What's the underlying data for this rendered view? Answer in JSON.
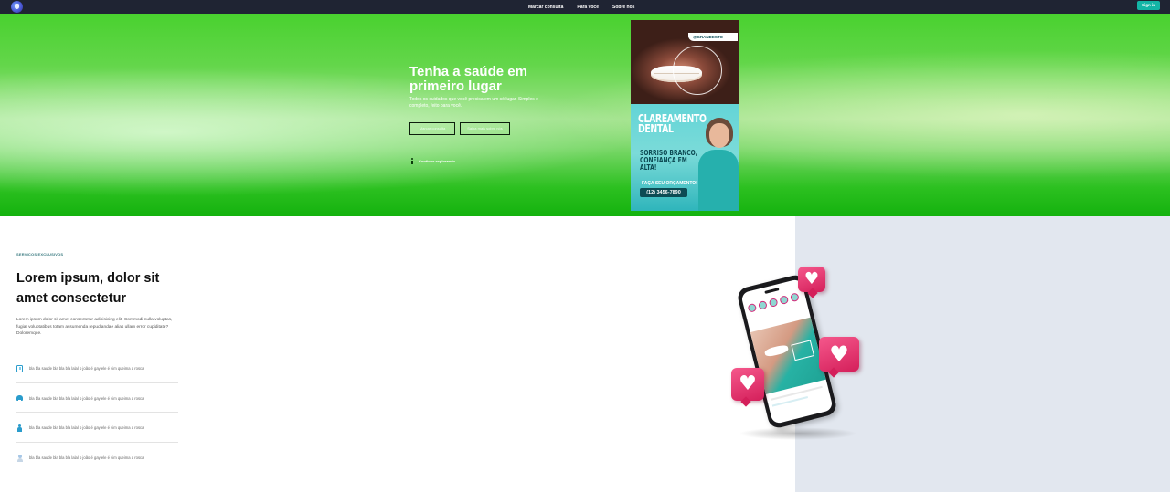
{
  "nav": {
    "links": [
      "Marcar consulta",
      "Para você",
      "Sobre nós"
    ],
    "signin_label": "Sign in"
  },
  "hero": {
    "title": "Tenha a saúde em primeiro lugar",
    "subtitle": "Todos os cuidados que você precisa em um só lugar. Simples e completo, feito para você.",
    "primary_button": "Marcar consulta",
    "secondary_button": "Saiba mais sobre nós",
    "scroll_hint": "Continue explorando"
  },
  "poster": {
    "handle": "@GRANDESTO",
    "title": "CLAREAMENTO DENTAL",
    "slogan": "SORRISO BRANCO, CONFIANÇA EM ALTA!",
    "cta": "FAÇA SEU ORÇAMENTO!",
    "phone": "(12) 3456-7890"
  },
  "services": {
    "eyebrow": "SERVIÇOS EXCLUSIVOS",
    "title": "Lorem ipsum, dolor sit amet consectetur",
    "paragraph": "Lorem ipsum dolor sit amet consectetur adipisicing elit. Commodi nulla voluptas, fugiat voluptatibus totam assumenda repudiandae alias ullam error cupiditate? Doloremque.",
    "features": [
      {
        "icon": "phone-icon",
        "text": "bla bla saude bla bla bla lalal o joão é gay ele é sim queima a rosca"
      },
      {
        "icon": "tooth-icon",
        "text": "bla bla saude bla bla bla lalal o joão é gay ele é sim queima a rosca"
      },
      {
        "icon": "user-icon",
        "text": "bla bla saude bla bla bla lalal o joão é gay ele é sim queima a rosca"
      },
      {
        "icon": "doctor-icon",
        "text": "bla bla saude bla bla bla lalal o joão é gay ele é sim queima a rosca"
      }
    ]
  },
  "colors": {
    "nav_bg": "#1f2433",
    "accent": "#13b5a6",
    "hero_green": "#49d12f",
    "panel_bg": "#e2e7ef",
    "heart": "#d41f5a"
  }
}
